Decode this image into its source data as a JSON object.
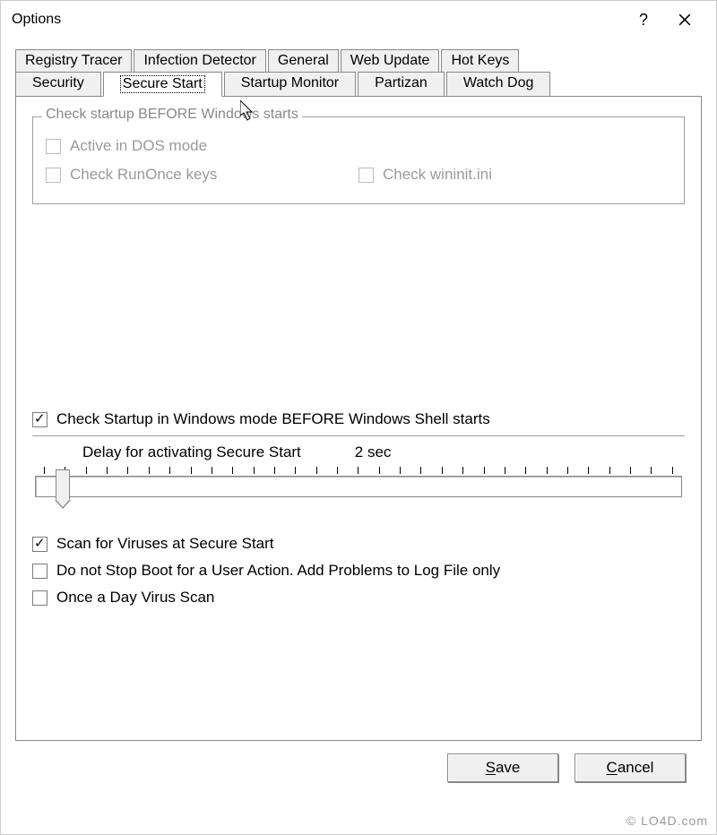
{
  "window": {
    "title": "Options"
  },
  "tabs_row1": [
    {
      "label": "Registry Tracer"
    },
    {
      "label": "Infection Detector"
    },
    {
      "label": "General"
    },
    {
      "label": "Web Update"
    },
    {
      "label": "Hot Keys"
    }
  ],
  "tabs_row2": [
    {
      "label": "Security"
    },
    {
      "label": "Secure Start",
      "active": true
    },
    {
      "label": "Startup Monitor"
    },
    {
      "label": "Partizan"
    },
    {
      "label": "Watch Dog"
    }
  ],
  "group": {
    "legend": "Check startup BEFORE Windows starts",
    "items": {
      "dos": "Active in DOS mode",
      "runonce": "Check RunOnce keys",
      "wininit": "Check wininit.ini"
    }
  },
  "main_check": {
    "label": "Check Startup in Windows mode BEFORE Windows Shell starts",
    "checked": true
  },
  "delay": {
    "label": "Delay for activating Secure Start",
    "value": "2 sec"
  },
  "lower": {
    "scan": {
      "label": "Scan for Viruses at Secure Start",
      "checked": true
    },
    "nostop": {
      "label": "Do not Stop Boot for a User Action. Add Problems to Log File only",
      "checked": false
    },
    "daily": {
      "label": "Once a Day Virus Scan",
      "checked": false
    }
  },
  "buttons": {
    "save": "Save",
    "cancel": "Cancel"
  },
  "watermark": "© LO4D.com"
}
